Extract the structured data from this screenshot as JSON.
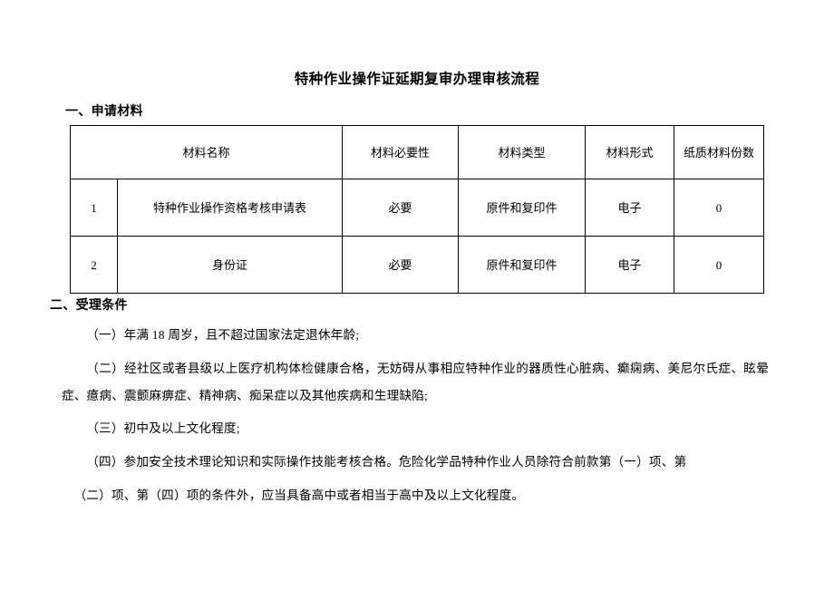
{
  "document": {
    "title": "特种作业操作证延期复审办理审核流程"
  },
  "sections": [
    {
      "heading": "一、申请材料"
    },
    {
      "heading": "二、受理条件"
    }
  ],
  "materials_table": {
    "headers": {
      "index": "",
      "name": "材料名称",
      "necessity": "材料必要性",
      "type": "材料类型",
      "form": "材料形式",
      "paper_copies": "纸质材料份数"
    },
    "rows": [
      {
        "index": "1",
        "name": "特种作业操作资格考核申请表",
        "necessity": "必要",
        "type": "原件和复印件",
        "form": "电子",
        "paper_copies": "0"
      },
      {
        "index": "2",
        "name": "身份证",
        "necessity": "必要",
        "type": "原件和复印件",
        "form": "电子",
        "paper_copies": "0"
      }
    ]
  },
  "conditions": [
    "（一）年满 18 周岁，且不超过国家法定退休年龄;",
    "（二）经社区或者县级以上医疗机构体检健康合格，无妨碍从事相应特种作业的器质性心脏病、癫痫病、美尼尔氏症、眩晕症、癔病、震颤麻痹症、精神病、痴呆症以及其他疾病和生理缺陷;",
    "（三）初中及以上文化程度;",
    "（四）参加安全技术理论知识和实际操作技能考核合格。危险化学品特种作业人员除符合前款第（一）项、第",
    "（二）项、第（四）项的条件外，应当具备高中或者相当于高中及以上文化程度。"
  ]
}
